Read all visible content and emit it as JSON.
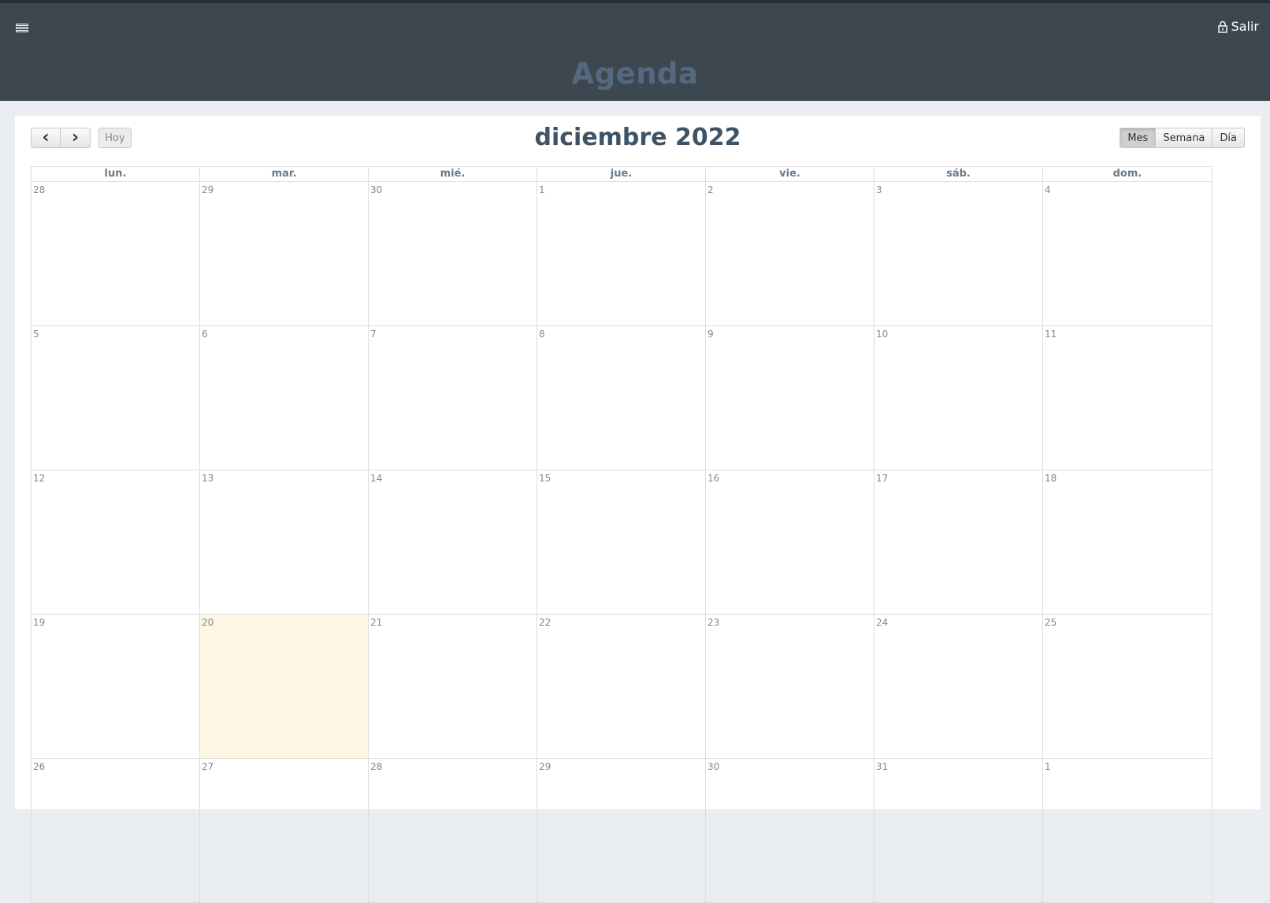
{
  "header": {
    "title": "Agenda",
    "logout_label": "Salir",
    "menu_icon": "hamburger-icon",
    "lock_icon": "lock-icon",
    "bg_color": "#3d4750"
  },
  "toolbar": {
    "prev_icon": "chevron-left-icon",
    "next_icon": "chevron-right-icon",
    "prev_glyph": "‹",
    "next_glyph": "›",
    "today_label": "Hoy",
    "month_title": "diciembre 2022",
    "views": [
      "Mes",
      "Semana",
      "Día"
    ],
    "active_view": "Mes"
  },
  "calendar": {
    "weekdays": [
      "lun.",
      "mar.",
      "mié.",
      "jue.",
      "vie.",
      "sáb.",
      "dom."
    ],
    "weeks": [
      [
        "28",
        "29",
        "30",
        "1",
        "2",
        "3",
        "4"
      ],
      [
        "5",
        "6",
        "7",
        "8",
        "9",
        "10",
        "11"
      ],
      [
        "12",
        "13",
        "14",
        "15",
        "16",
        "17",
        "18"
      ],
      [
        "19",
        "20",
        "21",
        "22",
        "23",
        "24",
        "25"
      ],
      [
        "26",
        "27",
        "28",
        "29",
        "30",
        "31",
        "1"
      ]
    ],
    "today": {
      "week": 3,
      "day": 1
    },
    "today_color": "#fcf6e2"
  }
}
